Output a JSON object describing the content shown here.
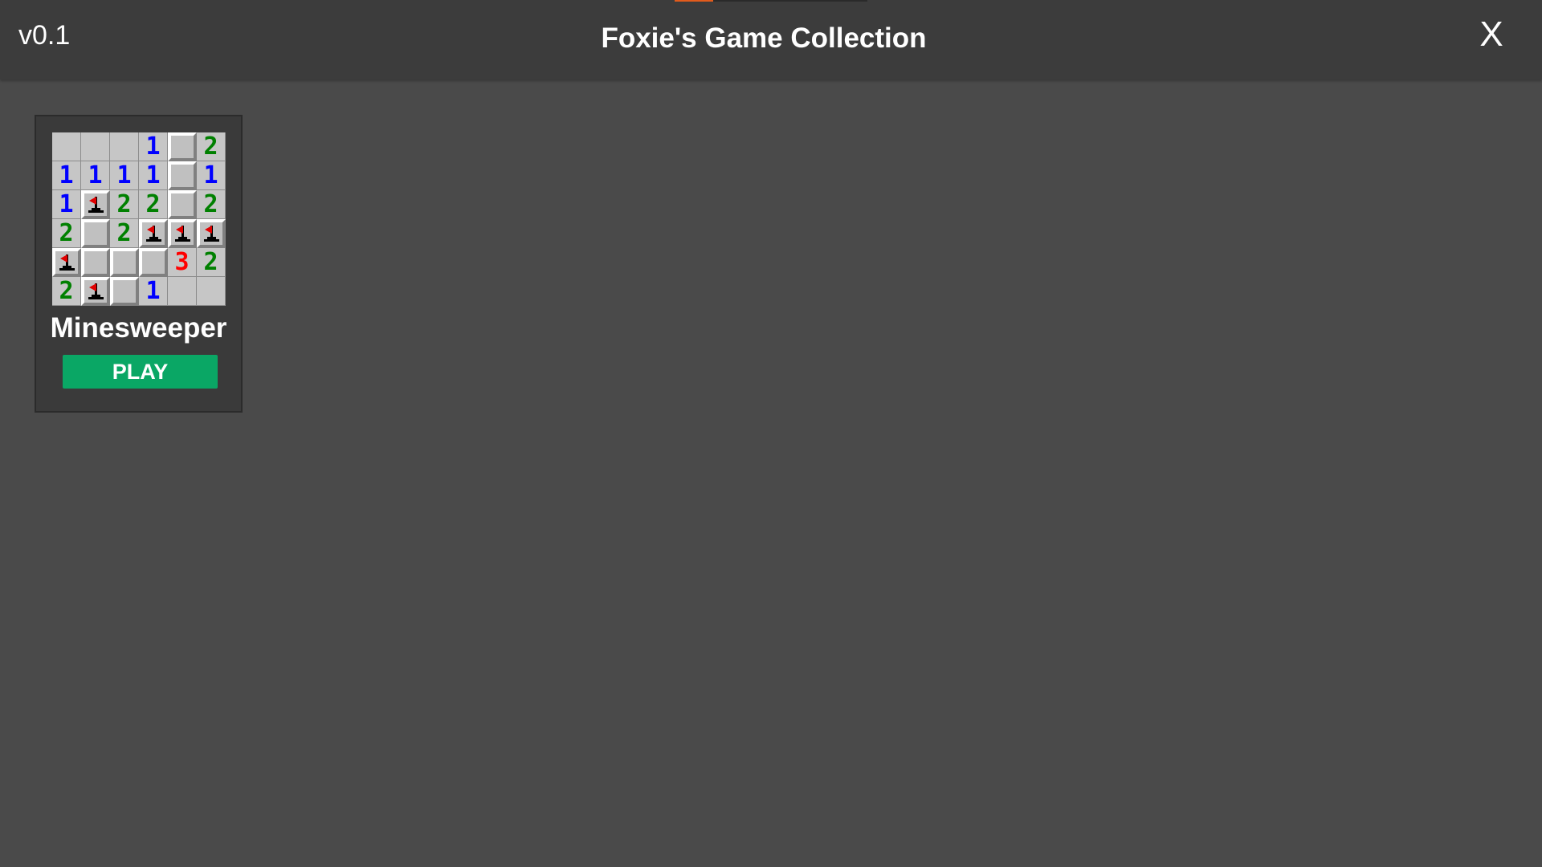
{
  "app": {
    "version": "v0.1",
    "title": "Foxie's Game Collection",
    "close_label": "X"
  },
  "games": [
    {
      "name": "Minesweeper",
      "play_label": "PLAY",
      "thumbnail": {
        "rows": [
          [
            "",
            "",
            "",
            "1",
            "C",
            "2"
          ],
          [
            "1",
            "1",
            "1",
            "1",
            "C",
            "1"
          ],
          [
            "1",
            "F",
            "2",
            "2",
            "C",
            "2"
          ],
          [
            "2",
            "C",
            "2",
            "F",
            "F",
            "F"
          ],
          [
            "F",
            "C",
            "C",
            "C",
            "3",
            "2"
          ],
          [
            "2",
            "F",
            "C",
            "1",
            "",
            ""
          ]
        ],
        "legend": {
          "C": "covered",
          "F": "flag",
          "": "empty"
        },
        "number_colors": {
          "1": "#0000ff",
          "2": "#008000",
          "3": "#ff0000"
        }
      }
    }
  ],
  "colors": {
    "background": "#4a4a4a",
    "header": "#3c3c3c",
    "card": "#3a3a3a",
    "play_button": "#0aa765",
    "accent": "#e25b1c"
  }
}
